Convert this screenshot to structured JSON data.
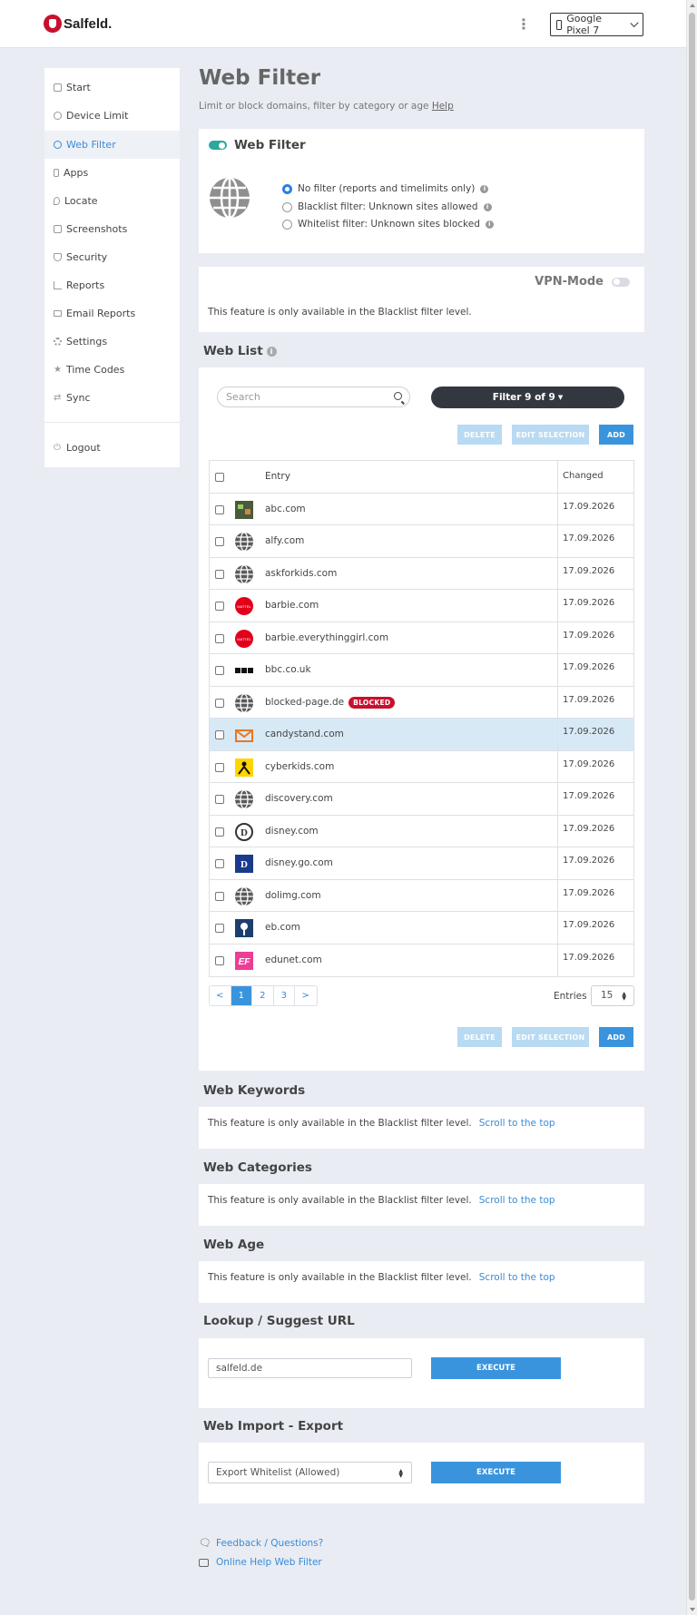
{
  "header": {
    "brand": "Salfeld.",
    "device_label": "Google Pixel 7"
  },
  "sidebar": {
    "items": [
      {
        "label": "Start",
        "icon": "home-icon"
      },
      {
        "label": "Device Limit",
        "icon": "clock-icon"
      },
      {
        "label": "Web Filter",
        "icon": "globe-icon",
        "active": true
      },
      {
        "label": "Apps",
        "icon": "phone-icon"
      },
      {
        "label": "Locate",
        "icon": "map-pin-icon"
      },
      {
        "label": "Screenshots",
        "icon": "camera-icon"
      },
      {
        "label": "Security",
        "icon": "shield-icon"
      },
      {
        "label": "Reports",
        "icon": "bar-chart-icon"
      },
      {
        "label": "Email Reports",
        "icon": "envelope-icon"
      },
      {
        "label": "Settings",
        "icon": "gear-icon"
      },
      {
        "label": "Time Codes",
        "icon": "star-icon"
      },
      {
        "label": "Sync",
        "icon": "sync-icon"
      }
    ],
    "logout": "Logout"
  },
  "page": {
    "title": "Web Filter",
    "subtitle": "Limit or block domains, filter by category or age",
    "help": "Help"
  },
  "webfilter": {
    "title": "Web Filter",
    "options": [
      {
        "label": "No filter (reports and timelimits only)",
        "checked": true
      },
      {
        "label": "Blacklist filter: Unknown sites allowed",
        "checked": false
      },
      {
        "label": "Whitelist filter: Unknown sites blocked",
        "checked": false
      }
    ]
  },
  "vpn": {
    "label": "VPN-Mode",
    "note": "This feature is only available in the Blacklist filter level."
  },
  "weblist": {
    "title": "Web List",
    "search_placeholder": "Search",
    "filter_label": "Filter 9 of 9",
    "delete": "DELETE",
    "edit_selection": "EDIT SELECTION",
    "add": "ADD",
    "col_entry": "Entry",
    "col_changed": "Changed",
    "rows": [
      {
        "entry": "abc.com",
        "changed": "17.09.2026"
      },
      {
        "entry": "alfy.com",
        "changed": "17.09.2026"
      },
      {
        "entry": "askforkids.com",
        "changed": "17.09.2026"
      },
      {
        "entry": "barbie.com",
        "changed": "17.09.2026"
      },
      {
        "entry": "barbie.everythinggirl.com",
        "changed": "17.09.2026"
      },
      {
        "entry": "bbc.co.uk",
        "changed": "17.09.2026"
      },
      {
        "entry": "blocked-page.de",
        "changed": "17.09.2026",
        "badge": "BLOCKED"
      },
      {
        "entry": "candystand.com",
        "changed": "17.09.2026"
      },
      {
        "entry": "cyberkids.com",
        "changed": "17.09.2026"
      },
      {
        "entry": "discovery.com",
        "changed": "17.09.2026"
      },
      {
        "entry": "disney.com",
        "changed": "17.09.2026"
      },
      {
        "entry": "disney.go.com",
        "changed": "17.09.2026"
      },
      {
        "entry": "dolimg.com",
        "changed": "17.09.2026"
      },
      {
        "entry": "eb.com",
        "changed": "17.09.2026"
      },
      {
        "entry": "edunet.com",
        "changed": "17.09.2026"
      }
    ],
    "pages": [
      "<",
      "1",
      "2",
      "3",
      ">"
    ],
    "current_page": "1",
    "entries_label": "Entries",
    "entries_value": "15"
  },
  "sections": {
    "keywords_title": "Web Keywords",
    "categories_title": "Web Categories",
    "age_title": "Web Age",
    "note": "This feature is only available in the Blacklist filter level.",
    "scroll_link": "Scroll to the top"
  },
  "lookup": {
    "title": "Lookup / Suggest URL",
    "value": "salfeld.de",
    "execute": "EXECUTE"
  },
  "import_export": {
    "title": "Web Import - Export",
    "selected": "Export Whitelist (Allowed)",
    "execute": "EXECUTE"
  },
  "footer": {
    "feedback": "Feedback / Questions?",
    "online_help": "Online Help Web Filter"
  }
}
